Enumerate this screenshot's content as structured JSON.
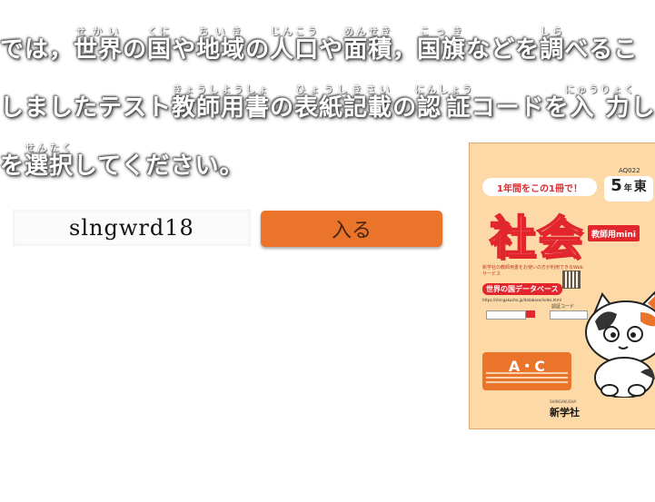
{
  "intro": {
    "line1": [
      {
        "text": "では，"
      },
      {
        "text": "世界",
        "ruby": "せかい"
      },
      {
        "text": "の"
      },
      {
        "text": "国",
        "ruby": "くに"
      },
      {
        "text": "や"
      },
      {
        "text": "地域",
        "ruby": "ちいき"
      },
      {
        "text": "の"
      },
      {
        "text": "人口",
        "ruby": "じんこう"
      },
      {
        "text": "や"
      },
      {
        "text": "面積",
        "ruby": "めんせき"
      },
      {
        "text": "，"
      },
      {
        "text": "国旗",
        "ruby": "こっき"
      },
      {
        "text": "などを"
      },
      {
        "text": "調",
        "ruby": "しら"
      },
      {
        "text": "べるこ"
      }
    ],
    "line2": [
      {
        "text": "しましたテスト"
      },
      {
        "text": "教師用書",
        "ruby": "きょうしようしょ"
      },
      {
        "text": "の"
      },
      {
        "text": "表紙記載",
        "ruby": "ひょうしきさい"
      },
      {
        "text": "の"
      },
      {
        "text": "認証",
        "ruby": "にんしょう"
      },
      {
        "text": "コードを"
      },
      {
        "text": "入力",
        "ruby": "にゅうりょく"
      },
      {
        "text": "し，"
      }
    ],
    "line3": [
      {
        "text": "を"
      },
      {
        "text": "選択",
        "ruby": "せんたく"
      },
      {
        "text": "してください。"
      }
    ]
  },
  "code_input": {
    "value": "slngwrd18"
  },
  "enter_button": {
    "label": "入る"
  },
  "book": {
    "banner": "1年間をこの1冊で！",
    "product_code": "AQ022",
    "grade_number": "5",
    "grade_unit": "年",
    "edition": "東",
    "subject": "社会",
    "teacher_label": "教師用mini",
    "info_text": "新学社の教師用書をお使いの方が利用できるWebサービス",
    "database_name": "世界の国データベース",
    "url_text": "https://shingakusha.jp/database/index.html",
    "code_label": "認証コード",
    "ac_label": "A・C",
    "publisher": "新学社",
    "publisher_sub": "SHINGAKUSHA"
  },
  "colors": {
    "button_bg": "#e9742a",
    "cover_bg": "#fcd9a6",
    "accent_red": "#e2262d"
  }
}
